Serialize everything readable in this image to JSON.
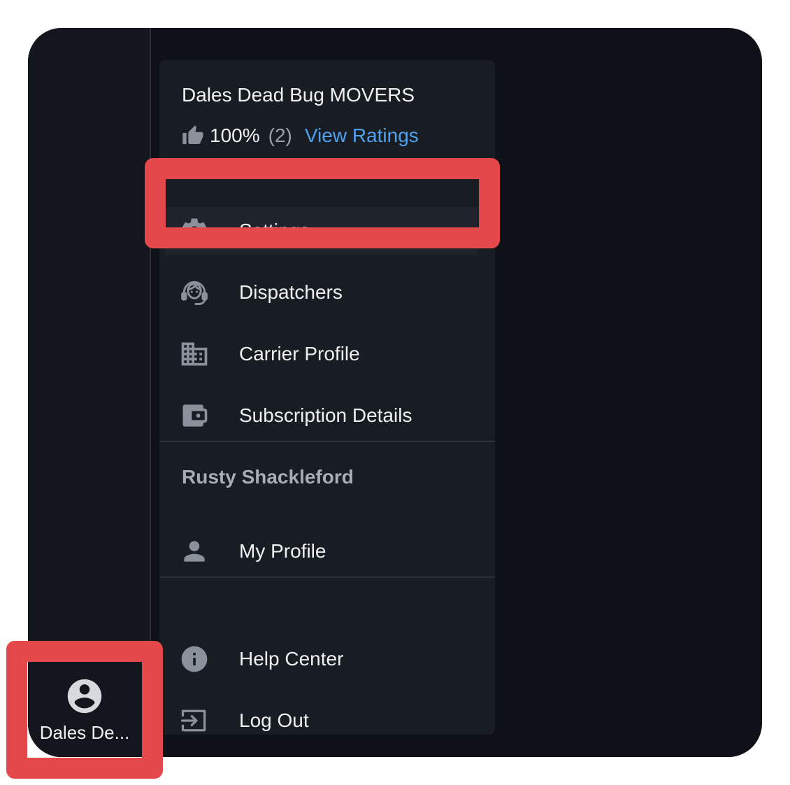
{
  "menu": {
    "org_name": "Dales Dead Bug MOVERS",
    "rating": {
      "percent": "100%",
      "count": "(2)",
      "view_label": "View Ratings"
    },
    "org_items": [
      {
        "label": "Settings",
        "icon": "gear-icon"
      },
      {
        "label": "Dispatchers",
        "icon": "headset-agent-icon"
      },
      {
        "label": "Carrier Profile",
        "icon": "building-icon"
      },
      {
        "label": "Subscription Details",
        "icon": "wallet-icon"
      }
    ],
    "user_name": "Rusty Shackleford",
    "user_items": [
      {
        "label": "My Profile",
        "icon": "person-icon"
      }
    ],
    "help_items": [
      {
        "label": "Help Center",
        "icon": "info-icon"
      },
      {
        "label": "Log Out",
        "icon": "logout-icon"
      }
    ]
  },
  "sidebar": {
    "account_label": "Dales De...",
    "account_icon": "account-circle-icon"
  },
  "colors": {
    "accent_link": "#4ea1ee",
    "highlight": "#e5484a",
    "background": "#0e1117",
    "menu_background": "#181c23"
  }
}
